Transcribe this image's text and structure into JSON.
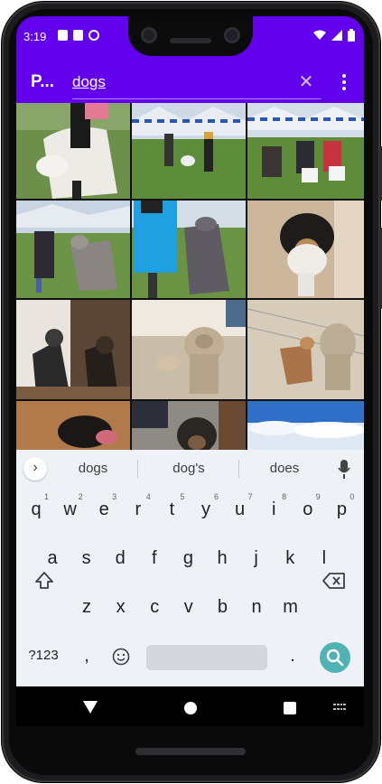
{
  "status_bar": {
    "time": "3:19"
  },
  "app_bar": {
    "title": "P...",
    "search_value": "dogs",
    "clear_icon": "close-icon",
    "overflow_icon": "more-vert-icon",
    "color": "#6200ee"
  },
  "photos": [
    {
      "label": "borzoi-dog"
    },
    {
      "label": "dog-show-tent"
    },
    {
      "label": "dog-show-spectators"
    },
    {
      "label": "wolfhound-with-handler"
    },
    {
      "label": "greyhound-with-handler"
    },
    {
      "label": "australian-shepherd"
    },
    {
      "label": "two-shepherd-dogs"
    },
    {
      "label": "dog-by-statue"
    },
    {
      "label": "dog-by-statue-2"
    },
    {
      "label": "black-dog-on-floor"
    },
    {
      "label": "dog-on-leash"
    },
    {
      "label": "clouds"
    }
  ],
  "keyboard": {
    "suggestions": [
      "dogs",
      "dog's",
      "does"
    ],
    "row1": [
      {
        "k": "q",
        "n": "1"
      },
      {
        "k": "w",
        "n": "2"
      },
      {
        "k": "e",
        "n": "3"
      },
      {
        "k": "r",
        "n": "4"
      },
      {
        "k": "t",
        "n": "5"
      },
      {
        "k": "y",
        "n": "6"
      },
      {
        "k": "u",
        "n": "7"
      },
      {
        "k": "i",
        "n": "8"
      },
      {
        "k": "o",
        "n": "9"
      },
      {
        "k": "p",
        "n": "0"
      }
    ],
    "row2": [
      "a",
      "s",
      "d",
      "f",
      "g",
      "h",
      "j",
      "k",
      "l"
    ],
    "row3": [
      "z",
      "x",
      "c",
      "v",
      "b",
      "n",
      "m"
    ],
    "symbols_label": "?123",
    "comma": ",",
    "period": ".",
    "accent_color": "#4fb3b3"
  }
}
